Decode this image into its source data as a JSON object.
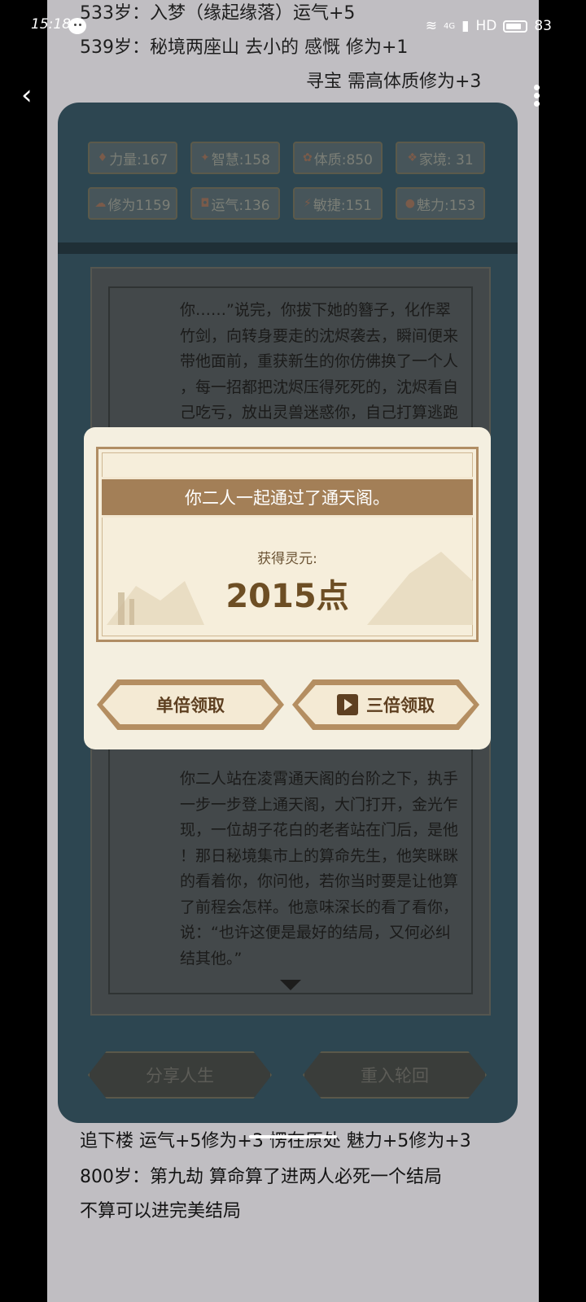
{
  "status_bar": {
    "time": "15:18",
    "network": "4G",
    "hd": "HD",
    "battery": "83"
  },
  "notes_top": [
    "533岁：入梦（缘起缘落）运气+5",
    "539岁：秘境两座山 去小的 感慨 修为+1",
    "寻宝 需高体质修为+3"
  ],
  "stats": [
    {
      "icon": "strength-icon",
      "glyph": "♦",
      "label": "力量:167"
    },
    {
      "icon": "wisdom-icon",
      "glyph": "✦",
      "label": "智慧:158"
    },
    {
      "icon": "constitution-icon",
      "glyph": "✿",
      "label": "体质:850"
    },
    {
      "icon": "family-icon",
      "glyph": "❖",
      "label": "家境: 31"
    },
    {
      "icon": "cultivation-icon",
      "glyph": "☁",
      "label": "修为1159"
    },
    {
      "icon": "luck-icon",
      "glyph": "◘",
      "label": "运气:136"
    },
    {
      "icon": "agility-icon",
      "glyph": "⚡",
      "label": "敏捷:151"
    },
    {
      "icon": "charm-icon",
      "glyph": "●",
      "label": "魅力:153"
    }
  ],
  "story_top": [
    "你……”说完，你拔下她的簪子，化作翠",
    "竹剑，向转身要走的沈烬袭去，瞬间便来",
    "带他面前，重获新生的你仿佛换了一个人",
    "，每一招都把沈烬压得死死的，沈烬看自",
    "己吃亏，放出灵兽迷惑你，自己打算逃跑"
  ],
  "story_bottom": [
    "你二人站在凌霄通天阁的台阶之下，执手",
    "一步一步登上通天阁，大门打开，金光乍",
    "现，一位胡子花白的老者站在门后，是他",
    "！那日秘境集市上的算命先生，他笑眯眯",
    "的看着你，你问他，若你当时要是让他算",
    "了前程会怎样。他意味深长的看了看你，",
    "说：“也许这便是最好的结局，又何必纠",
    "结其他。”"
  ],
  "bottom_buttons": {
    "share": "分享人生",
    "rebirth": "重入轮回"
  },
  "modal": {
    "title": "你二人一起通过了通天阁。",
    "reward_label": "获得灵元:",
    "reward_value": "2015点",
    "single_claim": "单倍领取",
    "triple_claim": "三倍领取"
  },
  "notes_bottom": [
    "追下楼 运气+5修为+3   愣在原处 魅力+5修为+3",
    "800岁：第九劫 算命算了进两人必死一个结局",
    "不算可以进完美结局"
  ]
}
